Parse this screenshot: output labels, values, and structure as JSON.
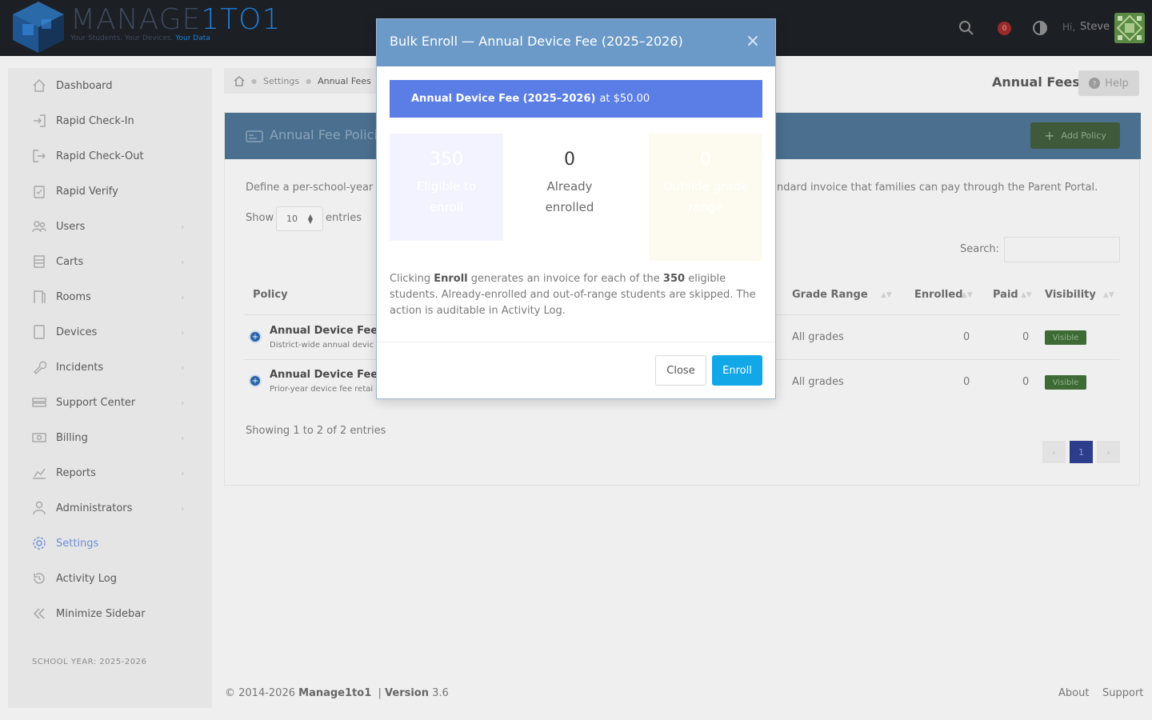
{
  "topbar": {
    "logo_word": "MANAGE",
    "logo_word_accent": "1TO1",
    "logo_tagline": "Your Students. Your Devices.",
    "logo_tagline_accent": "Your Data",
    "notification_count": "0",
    "greeting": "Hi,",
    "user_name": "Steve"
  },
  "sidebar": {
    "items": [
      {
        "label": "Dashboard",
        "icon": "home-icon",
        "chevron": false
      },
      {
        "label": "Rapid Check-In",
        "icon": "sign-in-icon",
        "chevron": false
      },
      {
        "label": "Rapid Check-Out",
        "icon": "sign-out-icon",
        "chevron": false
      },
      {
        "label": "Rapid Verify",
        "icon": "clipboard-check-icon",
        "chevron": false
      },
      {
        "label": "Users",
        "icon": "users-icon",
        "chevron": true
      },
      {
        "label": "Carts",
        "icon": "cart-icon",
        "chevron": true
      },
      {
        "label": "Rooms",
        "icon": "door-icon",
        "chevron": true
      },
      {
        "label": "Devices",
        "icon": "tablet-icon",
        "chevron": true
      },
      {
        "label": "Incidents",
        "icon": "wrench-icon",
        "chevron": true
      },
      {
        "label": "Support Center",
        "icon": "server-icon",
        "chevron": true
      },
      {
        "label": "Billing",
        "icon": "money-icon",
        "chevron": true
      },
      {
        "label": "Reports",
        "icon": "chart-icon",
        "chevron": true
      },
      {
        "label": "Administrators",
        "icon": "admin-icon",
        "chevron": true
      },
      {
        "label": "Settings",
        "icon": "gear-icon",
        "chevron": false,
        "active": true
      },
      {
        "label": "Activity Log",
        "icon": "history-icon",
        "chevron": false
      },
      {
        "label": "Minimize Sidebar",
        "icon": "double-chevron-left-icon",
        "chevron": false
      }
    ],
    "school_year": "SCHOOL YEAR: 2025-2026"
  },
  "breadcrumb": {
    "items": [
      "Settings",
      "Annual Fees"
    ]
  },
  "page": {
    "title": "Annual Fees",
    "help_label": "Help"
  },
  "card": {
    "title": "Annual Fee Polici",
    "add_label": "Add Policy",
    "description_start": "Define a per-school-year",
    "description_end": "ndard invoice that families can pay through the Parent Portal.",
    "show_label": "Show",
    "page_length": "10",
    "entries_label": "entries",
    "search_label": "Search:",
    "columns": [
      "Policy",
      "Grade Range",
      "Enrolled",
      "Paid",
      "Visibility"
    ],
    "rows": [
      {
        "name": "Annual Device Fee",
        "sub": "District-wide annual devic",
        "grade": "All grades",
        "enrolled": "0",
        "paid": "0",
        "visibility": "Visible"
      },
      {
        "name": "Annual Device Fee",
        "sub": "Prior-year device fee retai",
        "grade": "All grades",
        "enrolled": "0",
        "paid": "0",
        "visibility": "Visible"
      }
    ],
    "showing": "Showing 1 to 2 of 2 entries",
    "current_page": "1"
  },
  "footer": {
    "copyright": "© 2014-2026",
    "brand": "Manage1to1",
    "version_label": "Version",
    "version": "3.6",
    "links": [
      "About",
      "Support"
    ]
  },
  "modal": {
    "title": "Bulk Enroll — Annual Device Fee (2025–2026)",
    "banner_bold": "Annual Device Fee (2025–2026)",
    "banner_rest": "at $50.00",
    "stats": [
      {
        "value": "350",
        "label": "Eligible to enroll"
      },
      {
        "value": "0",
        "label": "Already enrolled"
      },
      {
        "value": "0",
        "label": "Outside grade range"
      }
    ],
    "para_1": "Clicking",
    "para_bold_1": "Enroll",
    "para_2": "generates an invoice for each of the",
    "para_bold_2": "350",
    "para_3": "eligible students. Already-enrolled and out-of-range students are skipped. The action is auditable in Activity Log.",
    "close_label": "Close",
    "enroll_label": "Enroll"
  },
  "colors": {
    "topbar": "#1c1f24",
    "modal_header": "#6b9ac8",
    "banner": "#5a7de6",
    "enroll_button": "#12a8e8",
    "visible_badge": "#3e6a36"
  }
}
